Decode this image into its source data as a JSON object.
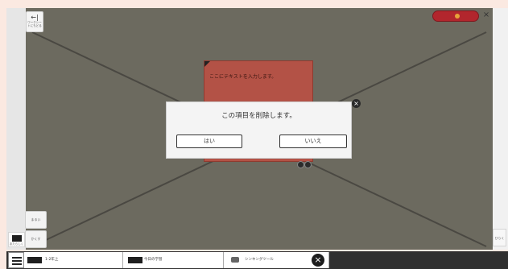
{
  "toolbar": {
    "back_label": "ワークシートにもどる",
    "close_label": "×"
  },
  "note": {
    "placeholder_text": "ここにテキストを入力します。",
    "close_label": "×"
  },
  "dialog": {
    "message": "この項目を削除します。",
    "yes_label": "はい",
    "no_label": "いいえ"
  },
  "side_tools": {
    "tool_a_label": "まるい",
    "tool_b_label": "かくす",
    "mini_caption": "あたらしく"
  },
  "right_panel": {
    "label": "ひらく"
  },
  "bottom_tabs": [
    {
      "label": "1-2年上"
    },
    {
      "label": "今日の学習"
    },
    {
      "label": "シンキングツール"
    }
  ],
  "bottom_close_label": "×",
  "colors": {
    "canvas": "#6c6a5f",
    "note": "#b35246",
    "accent_pill": "#b2262d",
    "page_bg": "#fbe9e1"
  }
}
